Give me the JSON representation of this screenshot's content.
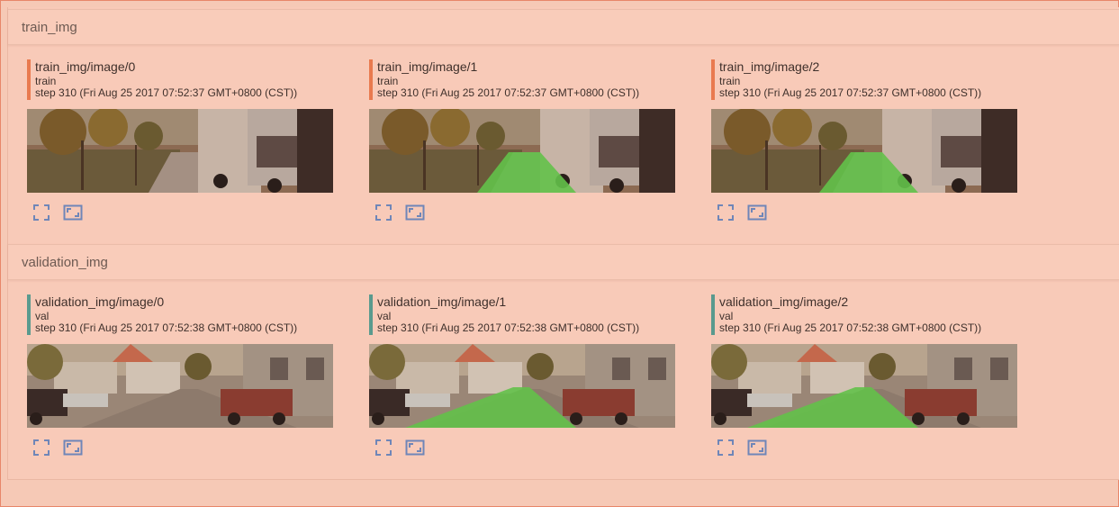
{
  "colors": {
    "train_bar": "#e97a4f",
    "val_bar": "#5a9a8e",
    "icon": "#6f86b8",
    "road_overlay": "#63c14a"
  },
  "sections": [
    {
      "title": "train_img",
      "cards": [
        {
          "title": "train_img/image/0",
          "run": "train",
          "step": "step 310 (Fri Aug 25 2017 07:52:37 GMT+0800 (CST))",
          "overlay": false,
          "scene": "train"
        },
        {
          "title": "train_img/image/1",
          "run": "train",
          "step": "step 310 (Fri Aug 25 2017 07:52:37 GMT+0800 (CST))",
          "overlay": true,
          "scene": "train"
        },
        {
          "title": "train_img/image/2",
          "run": "train",
          "step": "step 310 (Fri Aug 25 2017 07:52:37 GMT+0800 (CST))",
          "overlay": true,
          "scene": "train"
        }
      ]
    },
    {
      "title": "validation_img",
      "cards": [
        {
          "title": "validation_img/image/0",
          "run": "val",
          "step": "step 310 (Fri Aug 25 2017 07:52:38 GMT+0800 (CST))",
          "overlay": false,
          "scene": "val"
        },
        {
          "title": "validation_img/image/1",
          "run": "val",
          "step": "step 310 (Fri Aug 25 2017 07:52:38 GMT+0800 (CST))",
          "overlay": true,
          "scene": "val"
        },
        {
          "title": "validation_img/image/2",
          "run": "val",
          "step": "step 310 (Fri Aug 25 2017 07:52:38 GMT+0800 (CST))",
          "overlay": true,
          "scene": "val"
        }
      ]
    }
  ],
  "icons": {
    "fullscreen": "fullscreen-icon",
    "actual_size": "actual-size-icon"
  }
}
